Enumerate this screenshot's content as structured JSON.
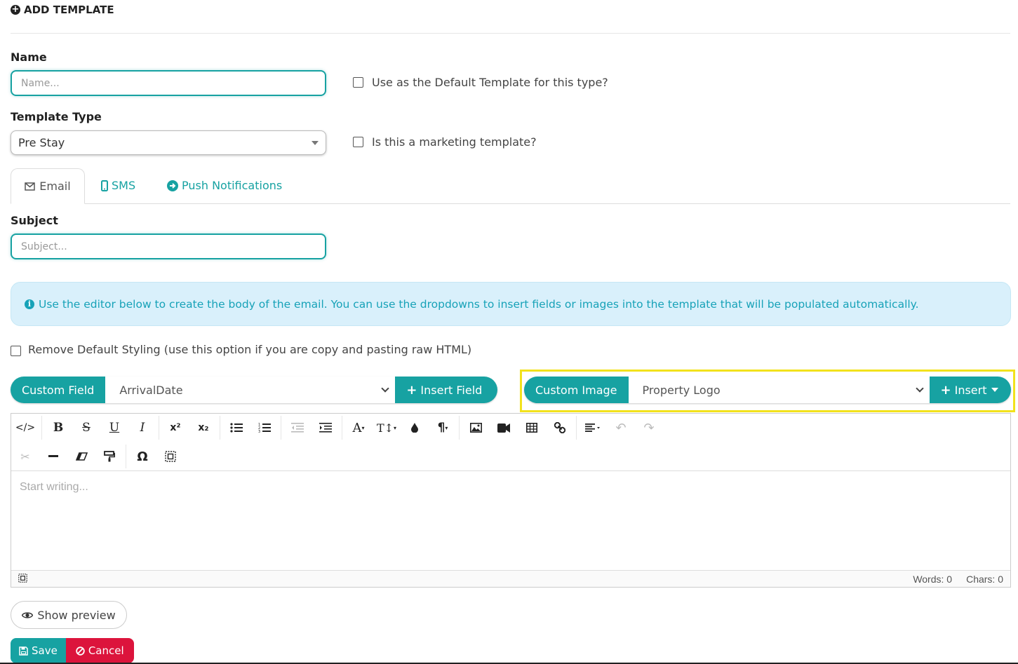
{
  "header": {
    "title": "ADD TEMPLATE",
    "icon": "plus-circle-icon"
  },
  "form": {
    "name_label": "Name",
    "name_placeholder": "Name...",
    "default_template_label": "Use as the Default Template for this type?",
    "template_type_label": "Template Type",
    "template_type_value": "Pre Stay",
    "marketing_label": "Is this a marketing template?"
  },
  "tabs": [
    {
      "label": "Email",
      "icon": "envelope-icon",
      "active": true
    },
    {
      "label": "SMS",
      "icon": "mobile-icon",
      "active": false
    },
    {
      "label": "Push Notifications",
      "icon": "arrow-circle-right-icon",
      "active": false
    }
  ],
  "subject": {
    "label": "Subject",
    "placeholder": "Subject..."
  },
  "alert": {
    "text": "Use the editor below to create the body of the email. You can use the dropdowns to insert fields or images into the template that will be populated automatically."
  },
  "remove_styling_label": "Remove Default Styling (use this option if you are copy and pasting raw HTML)",
  "custom_field": {
    "label": "Custom Field",
    "value": "ArrivalDate",
    "button": "Insert Field"
  },
  "custom_image": {
    "label": "Custom Image",
    "value": "Property Logo",
    "button": "Insert"
  },
  "editor": {
    "placeholder": "Start writing...",
    "words": "Words: 0",
    "chars": "Chars: 0"
  },
  "buttons": {
    "preview": "Show preview",
    "save": "Save",
    "cancel": "Cancel"
  },
  "colors": {
    "accent": "#17a2a2",
    "alert_bg": "#d9f0fb",
    "alert_text": "#17a2b8",
    "danger": "#dc143c",
    "highlight": "#f2e21c"
  }
}
